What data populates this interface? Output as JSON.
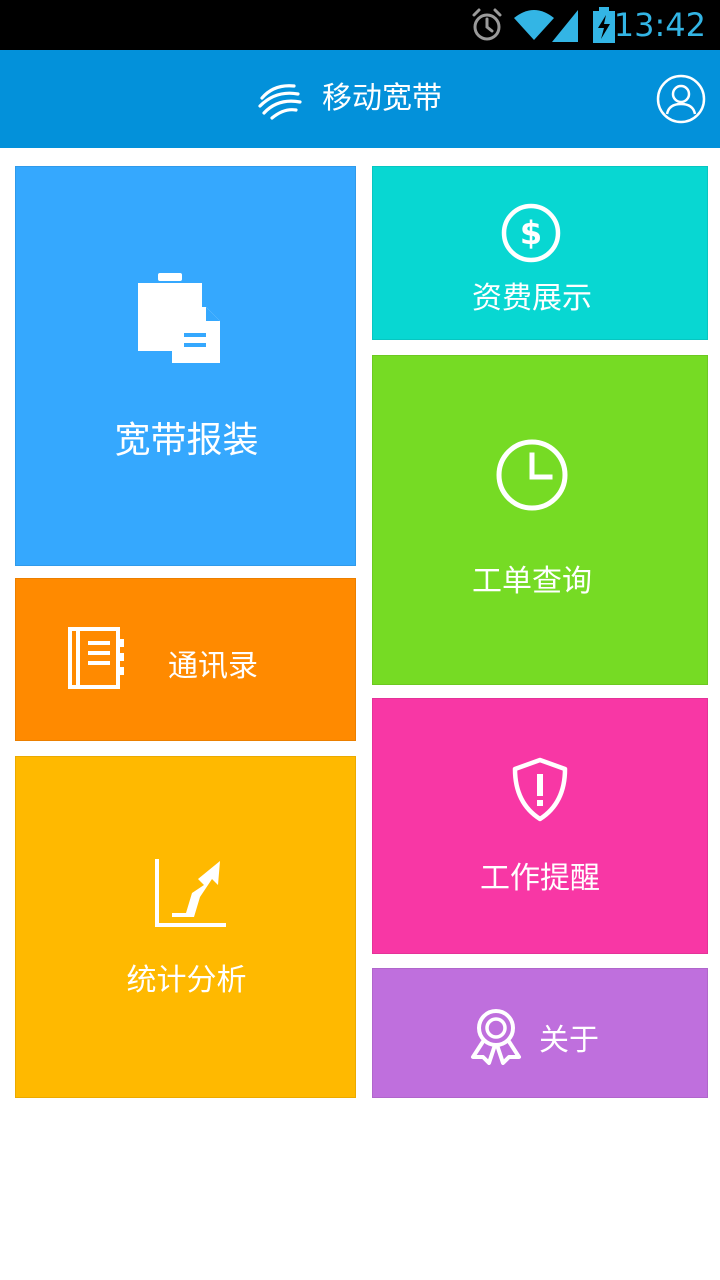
{
  "status_bar": {
    "time": "13:42",
    "icons": [
      "alarm-icon",
      "wifi-icon",
      "cell-signal-icon",
      "battery-charging-icon"
    ],
    "accent": "#33b5e5"
  },
  "app_bar": {
    "title": "移动宽带",
    "logo_icon": "china-mobile-logo-icon",
    "profile_icon": "user-profile-icon",
    "background": "#0391da"
  },
  "tiles": {
    "broadband_install": {
      "label": "宽带报装",
      "icon": "clipboard-document-icon",
      "color": "#35a8fe"
    },
    "tariff_display": {
      "label": "资费展示",
      "icon": "dollar-circle-icon",
      "color": "#08d7d2"
    },
    "work_order_query": {
      "label": "工单查询",
      "icon": "clock-icon",
      "color": "#76db24"
    },
    "contacts": {
      "label": "通讯录",
      "icon": "address-book-icon",
      "color": "#ff8a00"
    },
    "work_reminder": {
      "label": "工作提醒",
      "icon": "shield-alert-icon",
      "color": "#f837a5"
    },
    "statistics": {
      "label": "统计分析",
      "icon": "trend-chart-icon",
      "color": "#ffb900"
    },
    "about": {
      "label": "关于",
      "icon": "award-ribbon-icon",
      "color": "#bf6fdd"
    }
  }
}
